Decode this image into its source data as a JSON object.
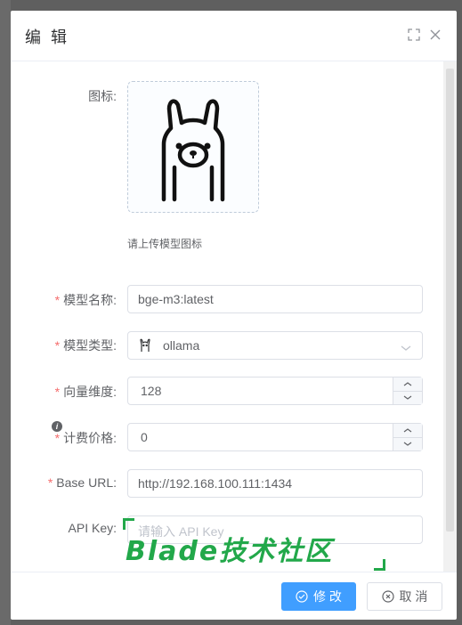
{
  "dialog": {
    "title": "编 辑",
    "fullscreen_icon": "fullscreen-icon",
    "close_icon": "close-icon"
  },
  "form": {
    "icon": {
      "label": "图标:",
      "hint": "请上传模型图标",
      "image_icon": "llama-logo"
    },
    "model_name": {
      "label": "模型名称:",
      "required": true,
      "value": "bge-m3:latest"
    },
    "model_type": {
      "label": "模型类型:",
      "required": true,
      "value": "ollama",
      "option_icon": "llama-icon",
      "arrow_icon": "chevron-down-icon"
    },
    "vector_dim": {
      "label": "向量维度:",
      "required": true,
      "value": "128"
    },
    "price": {
      "label": "计费价格:",
      "required": true,
      "value": "0",
      "info_icon": "info-icon"
    },
    "base_url": {
      "label": "Base URL:",
      "required": true,
      "value": "http://192.168.100.111:1434"
    },
    "api_key": {
      "label": "API Key:",
      "required": false,
      "placeholder": "请输入 API Key"
    }
  },
  "footer": {
    "confirm_label": "修 改",
    "cancel_label": "取 消",
    "confirm_icon": "check-circle-icon",
    "cancel_icon": "close-circle-icon"
  },
  "watermark": {
    "text": "Blade技术社区"
  },
  "colors": {
    "primary": "#409eff",
    "required": "#f56c6c",
    "watermark": "#22a84a"
  }
}
